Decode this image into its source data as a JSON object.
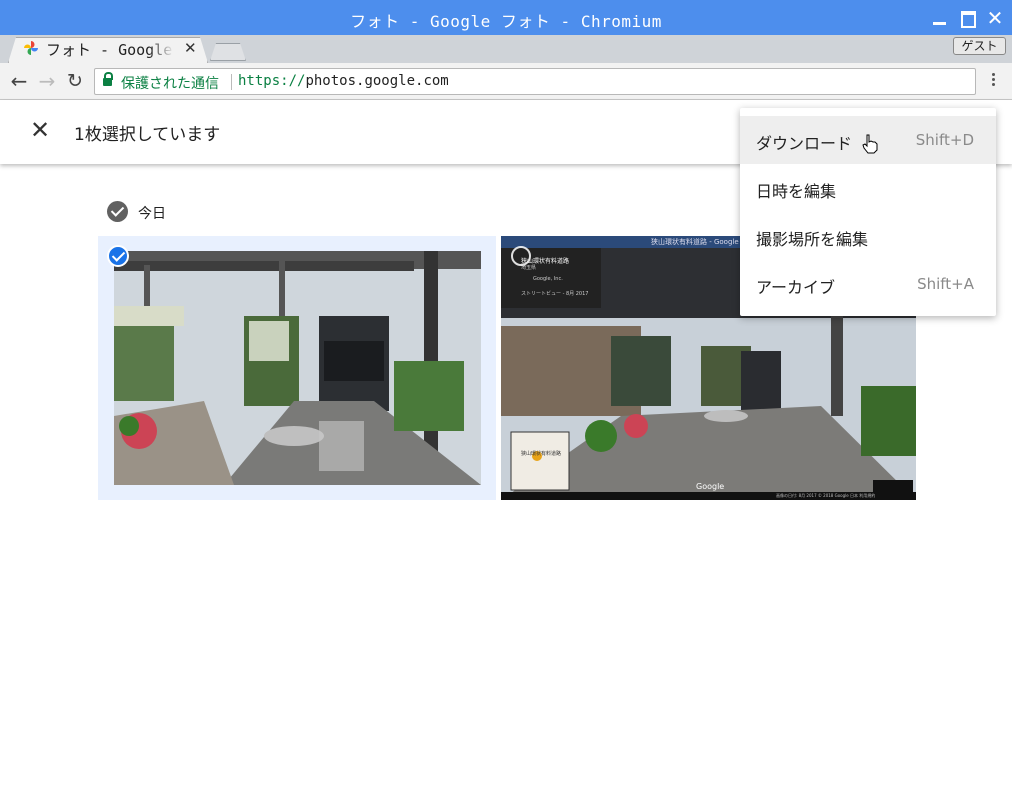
{
  "window": {
    "title": "フォト - Google フォト - Chromium"
  },
  "tabs": [
    {
      "title": "フォト - Google フォト",
      "active": true
    }
  ],
  "profile": {
    "label": "ゲスト"
  },
  "omnibox": {
    "security_label": "保護された通信",
    "url_scheme": "https://",
    "url_host": "photos.google.com"
  },
  "appbar": {
    "selection_text": "1枚選択しています"
  },
  "content": {
    "date_group": "今日"
  },
  "context_menu": {
    "items": [
      {
        "label": "ダウンロード",
        "shortcut": "Shift+D",
        "hovered": true
      },
      {
        "label": "日時を編集",
        "shortcut": ""
      },
      {
        "label": "撮影場所を編集",
        "shortcut": ""
      },
      {
        "label": "アーカイブ",
        "shortcut": "Shift+A"
      }
    ]
  },
  "photos": [
    {
      "selected": true,
      "icon": "check-icon"
    },
    {
      "selected": false,
      "icon": "circle-icon",
      "overlay": {
        "header": "狭山環状有料道路 - Google",
        "place": "狭山環状有料道路",
        "region": "埼玉県",
        "owner": "Google, Inc.",
        "street_view": "ストリートビュー - 8月 2017",
        "map_label": "狭山環状有料道路",
        "brand": "Google",
        "footer": "画像の日付: 8月 2017 © 2018 Google 日本 利用規約"
      }
    }
  ],
  "colors": {
    "titlebar": "#4d8eed",
    "secure": "#0b8043",
    "selection_blue": "#1a73e8",
    "selection_bg": "#e8f0fe"
  }
}
